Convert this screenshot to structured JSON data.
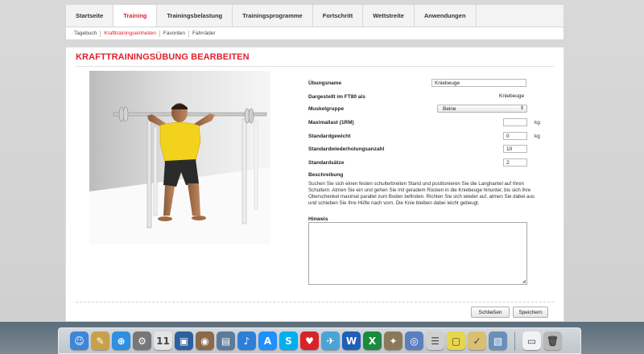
{
  "nav": {
    "items": [
      "Startseite",
      "Training",
      "Trainingsbelastung",
      "Trainingsprogramme",
      "Fortschritt",
      "Wettstreite",
      "Anwendungen"
    ],
    "active_index": 1
  },
  "subnav": {
    "items": [
      "Tagebuch",
      "Krafttrainingseinheiten",
      "Favoriten",
      "Fahrräder"
    ],
    "active_index": 1
  },
  "page": {
    "title": "KRAFTTRAININGSÜBUNG BEARBEITEN"
  },
  "form": {
    "name_label": "Übungsname",
    "name_value": "Kniebeuge",
    "shown_label": "Dargestellt im FT80 als",
    "shown_value": "Kniebeuge",
    "muscle_label": "Muskelgruppe",
    "muscle_value": "Beine",
    "max_label": "Maximallast (1RM)",
    "max_value": "",
    "max_unit": "kg",
    "weight_label": "Standardgewicht",
    "weight_value": "0",
    "weight_unit": "kg",
    "reps_label": "Standardwiederholungsanzahl",
    "reps_value": "10",
    "sets_label": "Standardsätze",
    "sets_value": "2",
    "desc_label": "Beschreibung",
    "desc_text": "Suchen Sie sich einen festen schulterbreiten Stand und positionieren Sie die Langhantel auf Ihren Schultern. Atmen Sie ein und gehen Sie mit geradem Rücken in die Kniebeuge hinunter, bis sich Ihre Oberschenkel maximal parallel zum Boden befinden. Richten Sie sich wieder auf, atmen Sie dabei aus und schieben Sie Ihre Hüfte nach vorn. Die Knie bleiben dabei leicht gebeugt.",
    "note_label": "Hinweis",
    "note_value": ""
  },
  "buttons": {
    "close": "Schließen",
    "save": "Speichern"
  },
  "dock": {
    "icons": [
      {
        "name": "finder-icon",
        "glyph": "☺",
        "color": "#3f86d8"
      },
      {
        "name": "notes-icon",
        "glyph": "✎",
        "color": "#c9a04a"
      },
      {
        "name": "safari-icon",
        "glyph": "⊕",
        "color": "#2f8fe0"
      },
      {
        "name": "system-preferences-icon",
        "glyph": "⚙",
        "color": "#777777"
      },
      {
        "name": "calendar-icon",
        "glyph": "11",
        "color": "#e4e4e4"
      },
      {
        "name": "virtualbox-icon",
        "glyph": "▣",
        "color": "#2c5f9e"
      },
      {
        "name": "photo-icon",
        "glyph": "◉",
        "color": "#8a6a4a"
      },
      {
        "name": "preview-icon",
        "glyph": "▤",
        "color": "#5c7a99"
      },
      {
        "name": "itunes-icon",
        "glyph": "♪",
        "color": "#2d7fd8"
      },
      {
        "name": "app-store-icon",
        "glyph": "A",
        "color": "#1e90ff"
      },
      {
        "name": "skype-icon",
        "glyph": "S",
        "color": "#00aff0"
      },
      {
        "name": "heart-icon",
        "glyph": "♥",
        "color": "#d8232a"
      },
      {
        "name": "bird-icon",
        "glyph": "✈",
        "color": "#4ba3d6"
      },
      {
        "name": "word-icon",
        "glyph": "W",
        "color": "#1f5fb8"
      },
      {
        "name": "excel-icon",
        "glyph": "X",
        "color": "#1c8a3d"
      },
      {
        "name": "gimp-icon",
        "glyph": "✦",
        "color": "#8b7a5a"
      },
      {
        "name": "sync-icon",
        "glyph": "◎",
        "color": "#5a7fbf"
      },
      {
        "name": "list-icon",
        "glyph": "☰",
        "color": "#cfcfcf"
      },
      {
        "name": "stickies-icon",
        "glyph": "▢",
        "color": "#e8d54a"
      },
      {
        "name": "clipboard-icon",
        "glyph": "✓",
        "color": "#d8c070"
      },
      {
        "name": "preview-image-icon",
        "glyph": "▧",
        "color": "#6b8fb8"
      },
      {
        "name": "document-icon",
        "glyph": "▭",
        "color": "#f2f2f2"
      },
      {
        "name": "trash-icon",
        "glyph": "🗑",
        "color": "#b8b8b8"
      }
    ]
  }
}
